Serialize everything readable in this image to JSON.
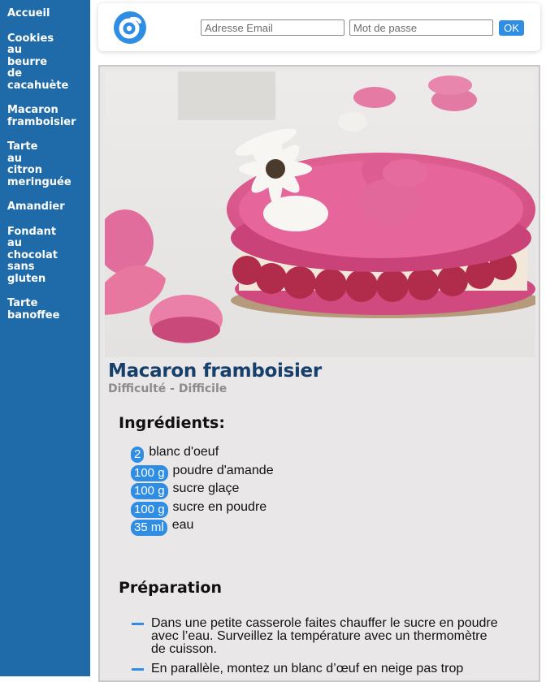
{
  "sidebar": {
    "items": [
      {
        "label": "Accueil"
      },
      {
        "label": "Cookies au beurre de cacahuète"
      },
      {
        "label": "Macaron framboisier"
      },
      {
        "label": "Tarte au citron meringuée"
      },
      {
        "label": "Amandier"
      },
      {
        "label": "Fondant au chocolat sans gluten"
      },
      {
        "label": "Tarte banoffee"
      }
    ]
  },
  "header": {
    "email_placeholder": "Adresse Email",
    "password_placeholder": "Mot de passe",
    "ok_label": "OK"
  },
  "recipe": {
    "title": "Macaron framboisier",
    "difficulty": "Difficulté - Difficile",
    "ingredients_heading": "Ingrédients:",
    "ingredients": [
      {
        "qty": "2",
        "name": "blanc d'oeuf"
      },
      {
        "qty": "100 g",
        "name": "poudre d'amande"
      },
      {
        "qty": "100 g",
        "name": "sucre glaçe"
      },
      {
        "qty": "100 g",
        "name": "sucre en poudre"
      },
      {
        "qty": "35 ml",
        "name": "eau"
      }
    ],
    "preparation_heading": "Préparation",
    "steps": [
      "Dans une petite casserole faites chauffer le sucre en poudre avec l’eau. Surveillez la température avec un thermomètre de cuisson.",
      "En parallèle, montez un blanc d’œuf en neige pas trop"
    ]
  },
  "colors": {
    "sidebar": "#1f6aa8",
    "accent": "#2f8de4",
    "title": "#16406b",
    "content_bg": "#e9e7e8"
  }
}
